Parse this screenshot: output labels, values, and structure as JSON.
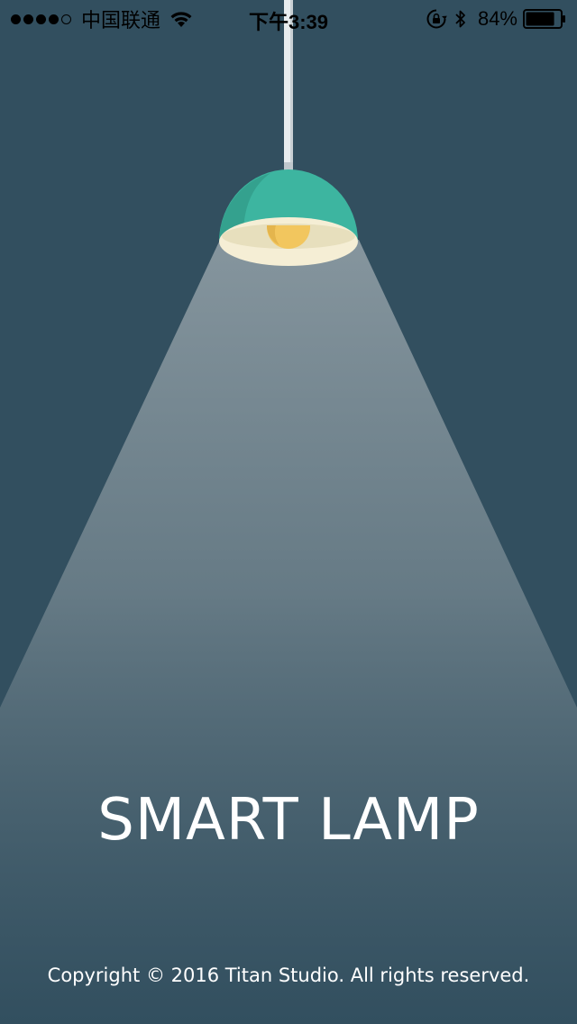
{
  "status_bar": {
    "signal_bars_filled": 4,
    "signal_bars_total": 5,
    "carrier": "中国联通",
    "time": "下午3:39",
    "battery_percent_label": "84%",
    "battery_level": 0.84,
    "icons": [
      "wifi-icon",
      "rotation-lock-icon",
      "bluetooth-icon",
      "battery-icon"
    ]
  },
  "app": {
    "title": "SMART LAMP",
    "copyright": "Copyright © 2016 Titan Studio. All rights reserved."
  },
  "colors": {
    "background": "#324f5f",
    "lamp_shade": "#3db5a0",
    "lamp_shade_shadow": "#35a08d",
    "lamp_rim": "#f5eed5",
    "bulb": "#f2c65e",
    "cord": "#e8ecee",
    "light_beam": "#8a99a1"
  }
}
